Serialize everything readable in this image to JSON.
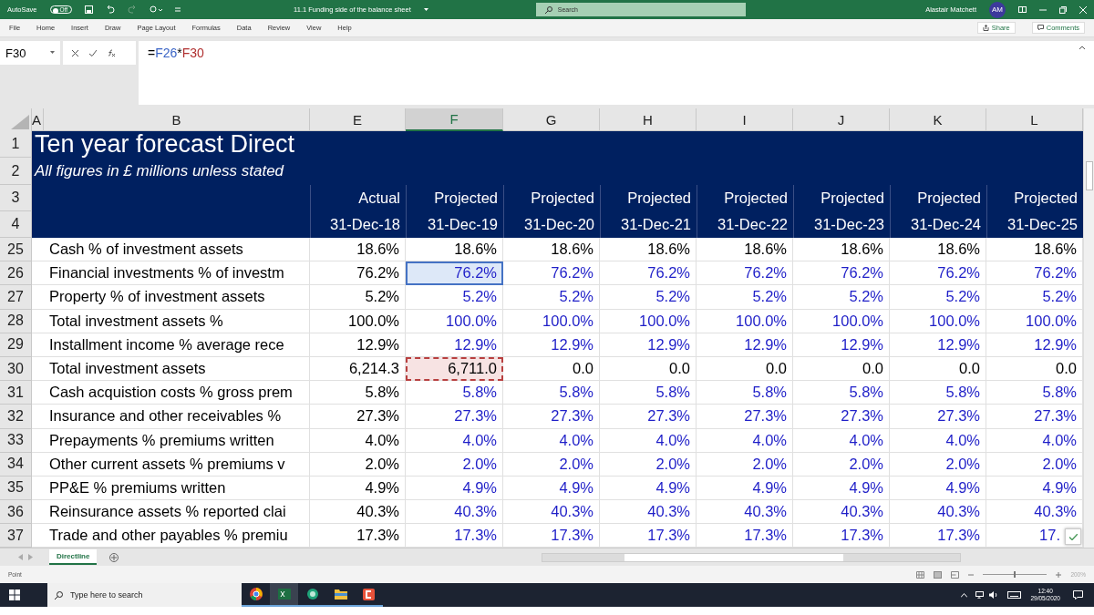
{
  "title_bar": {
    "autosave_label": "AutoSave",
    "autosave_state": "Off",
    "autosave_on": false,
    "doc_title": "11.1 Funding side of the balance sheet",
    "search_placeholder": "Search",
    "user_name": "Alastair Matchett",
    "user_initials": "AM"
  },
  "menu": {
    "items": [
      {
        "label": "File",
        "selected": false
      },
      {
        "label": "Home",
        "selected": false
      },
      {
        "label": "Insert",
        "selected": false
      },
      {
        "label": "Draw",
        "selected": false
      },
      {
        "label": "Page Layout",
        "selected": false
      },
      {
        "label": "Formulas",
        "selected": false
      },
      {
        "label": "Data",
        "selected": false
      },
      {
        "label": "Review",
        "selected": false
      },
      {
        "label": "View",
        "selected": false
      },
      {
        "label": "Help",
        "selected": false
      }
    ],
    "share": "Share",
    "comments": "Comments"
  },
  "formula_bar": {
    "name_box": "F30",
    "formula_prefix": "=",
    "ref_1": "F26",
    "operator": "*",
    "ref_2": "F30"
  },
  "columns": [
    {
      "label": "A",
      "selected": false
    },
    {
      "label": "B",
      "selected": false
    },
    {
      "label": "E",
      "selected": false
    },
    {
      "label": "F",
      "selected": true
    },
    {
      "label": "G",
      "selected": false
    },
    {
      "label": "H",
      "selected": false
    },
    {
      "label": "I",
      "selected": false
    },
    {
      "label": "J",
      "selected": false
    },
    {
      "label": "K",
      "selected": false
    },
    {
      "label": "L",
      "selected": false
    }
  ],
  "header": {
    "title": "Ten year forecast Direct",
    "subtitle": "All figures in £ millions unless stated",
    "row_numbers": [
      "1",
      "2",
      "3",
      "4"
    ],
    "periods": [
      {
        "type": "Actual",
        "date": "31-Dec-18"
      },
      {
        "type": "Projected",
        "date": "31-Dec-19"
      },
      {
        "type": "Projected",
        "date": "31-Dec-20"
      },
      {
        "type": "Projected",
        "date": "31-Dec-21"
      },
      {
        "type": "Projected",
        "date": "31-Dec-22"
      },
      {
        "type": "Projected",
        "date": "31-Dec-23"
      },
      {
        "type": "Projected",
        "date": "31-Dec-24"
      },
      {
        "type": "Projected",
        "date": "31-Dec-25"
      }
    ]
  },
  "rows": [
    {
      "num": "25",
      "label": "Cash % of investment assets",
      "input": false,
      "actual": "18.6%",
      "cells": [
        {
          "value": "18.6%",
          "selected": false,
          "copied": false
        },
        {
          "value": "18.6%",
          "selected": false,
          "copied": false
        },
        {
          "value": "18.6%",
          "selected": false,
          "copied": false
        },
        {
          "value": "18.6%",
          "selected": false,
          "copied": false
        },
        {
          "value": "18.6%",
          "selected": false,
          "copied": false
        },
        {
          "value": "18.6%",
          "selected": false,
          "copied": false
        },
        {
          "value": "18.6%",
          "selected": false,
          "copied": false
        }
      ]
    },
    {
      "num": "26",
      "label": "Financial investments % of investm",
      "input": true,
      "actual": "76.2%",
      "cells": [
        {
          "value": "76.2%",
          "selected": true,
          "copied": false
        },
        {
          "value": "76.2%",
          "selected": false,
          "copied": false
        },
        {
          "value": "76.2%",
          "selected": false,
          "copied": false
        },
        {
          "value": "76.2%",
          "selected": false,
          "copied": false
        },
        {
          "value": "76.2%",
          "selected": false,
          "copied": false
        },
        {
          "value": "76.2%",
          "selected": false,
          "copied": false
        },
        {
          "value": "76.2%",
          "selected": false,
          "copied": false
        }
      ]
    },
    {
      "num": "27",
      "label": "Property % of investment assets",
      "input": true,
      "actual": "5.2%",
      "cells": [
        {
          "value": "5.2%",
          "selected": false,
          "copied": false
        },
        {
          "value": "5.2%",
          "selected": false,
          "copied": false
        },
        {
          "value": "5.2%",
          "selected": false,
          "copied": false
        },
        {
          "value": "5.2%",
          "selected": false,
          "copied": false
        },
        {
          "value": "5.2%",
          "selected": false,
          "copied": false
        },
        {
          "value": "5.2%",
          "selected": false,
          "copied": false
        },
        {
          "value": "5.2%",
          "selected": false,
          "copied": false
        }
      ]
    },
    {
      "num": "28",
      "label": "Total investment assets %",
      "input": true,
      "actual": "100.0%",
      "cells": [
        {
          "value": "100.0%",
          "selected": false,
          "copied": false
        },
        {
          "value": "100.0%",
          "selected": false,
          "copied": false
        },
        {
          "value": "100.0%",
          "selected": false,
          "copied": false
        },
        {
          "value": "100.0%",
          "selected": false,
          "copied": false
        },
        {
          "value": "100.0%",
          "selected": false,
          "copied": false
        },
        {
          "value": "100.0%",
          "selected": false,
          "copied": false
        },
        {
          "value": "100.0%",
          "selected": false,
          "copied": false
        }
      ]
    },
    {
      "num": "29",
      "label": "Installment income % average rece",
      "input": true,
      "actual": "12.9%",
      "cells": [
        {
          "value": "12.9%",
          "selected": false,
          "copied": false
        },
        {
          "value": "12.9%",
          "selected": false,
          "copied": false
        },
        {
          "value": "12.9%",
          "selected": false,
          "copied": false
        },
        {
          "value": "12.9%",
          "selected": false,
          "copied": false
        },
        {
          "value": "12.9%",
          "selected": false,
          "copied": false
        },
        {
          "value": "12.9%",
          "selected": false,
          "copied": false
        },
        {
          "value": "12.9%",
          "selected": false,
          "copied": false
        }
      ]
    },
    {
      "num": "30",
      "label": "Total investment assets",
      "input": false,
      "actual": "6,214.3",
      "cells": [
        {
          "value": "6,711.0",
          "selected": false,
          "copied": true
        },
        {
          "value": "0.0",
          "selected": false,
          "copied": false
        },
        {
          "value": "0.0",
          "selected": false,
          "copied": false
        },
        {
          "value": "0.0",
          "selected": false,
          "copied": false
        },
        {
          "value": "0.0",
          "selected": false,
          "copied": false
        },
        {
          "value": "0.0",
          "selected": false,
          "copied": false
        },
        {
          "value": "0.0",
          "selected": false,
          "copied": false
        }
      ]
    },
    {
      "num": "31",
      "label": "Cash acquistion costs % gross prem",
      "input": true,
      "actual": "5.8%",
      "cells": [
        {
          "value": "5.8%",
          "selected": false,
          "copied": false
        },
        {
          "value": "5.8%",
          "selected": false,
          "copied": false
        },
        {
          "value": "5.8%",
          "selected": false,
          "copied": false
        },
        {
          "value": "5.8%",
          "selected": false,
          "copied": false
        },
        {
          "value": "5.8%",
          "selected": false,
          "copied": false
        },
        {
          "value": "5.8%",
          "selected": false,
          "copied": false
        },
        {
          "value": "5.8%",
          "selected": false,
          "copied": false
        }
      ]
    },
    {
      "num": "32",
      "label": "Insurance and other receivables %",
      "input": true,
      "actual": "27.3%",
      "cells": [
        {
          "value": "27.3%",
          "selected": false,
          "copied": false
        },
        {
          "value": "27.3%",
          "selected": false,
          "copied": false
        },
        {
          "value": "27.3%",
          "selected": false,
          "copied": false
        },
        {
          "value": "27.3%",
          "selected": false,
          "copied": false
        },
        {
          "value": "27.3%",
          "selected": false,
          "copied": false
        },
        {
          "value": "27.3%",
          "selected": false,
          "copied": false
        },
        {
          "value": "27.3%",
          "selected": false,
          "copied": false
        }
      ]
    },
    {
      "num": "33",
      "label": "Prepayments % premiums written",
      "input": true,
      "actual": "4.0%",
      "cells": [
        {
          "value": "4.0%",
          "selected": false,
          "copied": false
        },
        {
          "value": "4.0%",
          "selected": false,
          "copied": false
        },
        {
          "value": "4.0%",
          "selected": false,
          "copied": false
        },
        {
          "value": "4.0%",
          "selected": false,
          "copied": false
        },
        {
          "value": "4.0%",
          "selected": false,
          "copied": false
        },
        {
          "value": "4.0%",
          "selected": false,
          "copied": false
        },
        {
          "value": "4.0%",
          "selected": false,
          "copied": false
        }
      ]
    },
    {
      "num": "34",
      "label": "Other current assets % premiums v",
      "input": true,
      "actual": "2.0%",
      "cells": [
        {
          "value": "2.0%",
          "selected": false,
          "copied": false
        },
        {
          "value": "2.0%",
          "selected": false,
          "copied": false
        },
        {
          "value": "2.0%",
          "selected": false,
          "copied": false
        },
        {
          "value": "2.0%",
          "selected": false,
          "copied": false
        },
        {
          "value": "2.0%",
          "selected": false,
          "copied": false
        },
        {
          "value": "2.0%",
          "selected": false,
          "copied": false
        },
        {
          "value": "2.0%",
          "selected": false,
          "copied": false
        }
      ]
    },
    {
      "num": "35",
      "label": "PP&E % premiums written",
      "input": true,
      "actual": "4.9%",
      "cells": [
        {
          "value": "4.9%",
          "selected": false,
          "copied": false
        },
        {
          "value": "4.9%",
          "selected": false,
          "copied": false
        },
        {
          "value": "4.9%",
          "selected": false,
          "copied": false
        },
        {
          "value": "4.9%",
          "selected": false,
          "copied": false
        },
        {
          "value": "4.9%",
          "selected": false,
          "copied": false
        },
        {
          "value": "4.9%",
          "selected": false,
          "copied": false
        },
        {
          "value": "4.9%",
          "selected": false,
          "copied": false
        }
      ]
    },
    {
      "num": "36",
      "label": "Reinsurance assets % reported clai",
      "input": true,
      "actual": "40.3%",
      "cells": [
        {
          "value": "40.3%",
          "selected": false,
          "copied": false
        },
        {
          "value": "40.3%",
          "selected": false,
          "copied": false
        },
        {
          "value": "40.3%",
          "selected": false,
          "copied": false
        },
        {
          "value": "40.3%",
          "selected": false,
          "copied": false
        },
        {
          "value": "40.3%",
          "selected": false,
          "copied": false
        },
        {
          "value": "40.3%",
          "selected": false,
          "copied": false
        },
        {
          "value": "40.3%",
          "selected": false,
          "copied": false
        }
      ]
    },
    {
      "num": "37",
      "label": "Trade and other payables % premiu",
      "input": true,
      "actual": "17.3%",
      "cells": [
        {
          "value": "17.3%",
          "selected": false,
          "copied": false
        },
        {
          "value": "17.3%",
          "selected": false,
          "copied": false
        },
        {
          "value": "17.3%",
          "selected": false,
          "copied": false
        },
        {
          "value": "17.3%",
          "selected": false,
          "copied": false
        },
        {
          "value": "17.3%",
          "selected": false,
          "copied": false
        },
        {
          "value": "17.3%",
          "selected": false,
          "copied": false
        },
        {
          "value": "17.",
          "selected": false,
          "copied": false
        }
      ]
    }
  ],
  "sheet_tabs": [
    {
      "label": "Directline",
      "selected": true
    }
  ],
  "status_bar": {
    "mode": "Point",
    "zoom": "200%",
    "zoom_slider": {
      "level": 0.5
    }
  },
  "taskbar": {
    "search_placeholder": "Type here to search",
    "time": "12:40",
    "date": "29/05/2020"
  }
}
